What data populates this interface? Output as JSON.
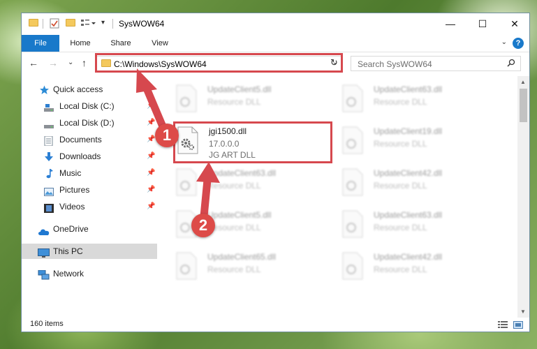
{
  "window": {
    "title": "SysWOW64",
    "controls": {
      "minimize": "—",
      "maximize": "☐",
      "close": "✕"
    }
  },
  "ribbon": {
    "tabs": [
      {
        "label": "File"
      },
      {
        "label": "Home"
      },
      {
        "label": "Share"
      },
      {
        "label": "View"
      }
    ],
    "help": "?"
  },
  "nav": {
    "address": "C:\\Windows\\SysWOW64",
    "search_placeholder": "Search SysWOW64"
  },
  "sidebar": {
    "items": [
      {
        "label": "Quick access",
        "icon": "star-icon",
        "pinned": false
      },
      {
        "label": "Local Disk (C:)",
        "icon": "drive-icon",
        "pinned": true
      },
      {
        "label": "Local Disk (D:)",
        "icon": "drive-icon",
        "pinned": true
      },
      {
        "label": "Documents",
        "icon": "documents-icon",
        "pinned": true
      },
      {
        "label": "Downloads",
        "icon": "download-arrow-icon",
        "pinned": true
      },
      {
        "label": "Music",
        "icon": "music-note-icon",
        "pinned": true
      },
      {
        "label": "Pictures",
        "icon": "pictures-icon",
        "pinned": true
      },
      {
        "label": "Videos",
        "icon": "film-icon",
        "pinned": true
      },
      {
        "label": "OneDrive",
        "icon": "cloud-icon",
        "pinned": false
      },
      {
        "label": "This PC",
        "icon": "monitor-icon",
        "pinned": false,
        "selected": true
      },
      {
        "label": "Network",
        "icon": "network-icon",
        "pinned": false
      }
    ]
  },
  "files": {
    "focus": {
      "name": "jgi1500.dll",
      "version": "17.0.0.0",
      "type": "JG ART DLL"
    },
    "blurred": [
      {
        "name": "UpdateClient5.dll",
        "type": "Resource DLL"
      },
      {
        "name": "UpdateClient63.dll",
        "type": "Resource DLL"
      },
      {
        "name": "UpdateClient19.dll",
        "type": "Resource DLL"
      },
      {
        "name": "UpdateClient63.dll",
        "type": "Resource DLL"
      },
      {
        "name": "UpdateClient42.dll",
        "type": "Resource DLL"
      },
      {
        "name": "UpdateClient5.dll",
        "type": "Resource DLL"
      },
      {
        "name": "UpdateClient63.dll",
        "type": "Resource DLL"
      },
      {
        "name": "UpdateClient65.dll",
        "type": "Resource DLL"
      },
      {
        "name": "UpdateClient42.dll",
        "type": "Resource DLL"
      }
    ]
  },
  "status": {
    "item_count": "160 items"
  },
  "annotations": {
    "marker1": "1",
    "marker2": "2",
    "color": "#d6484e"
  }
}
